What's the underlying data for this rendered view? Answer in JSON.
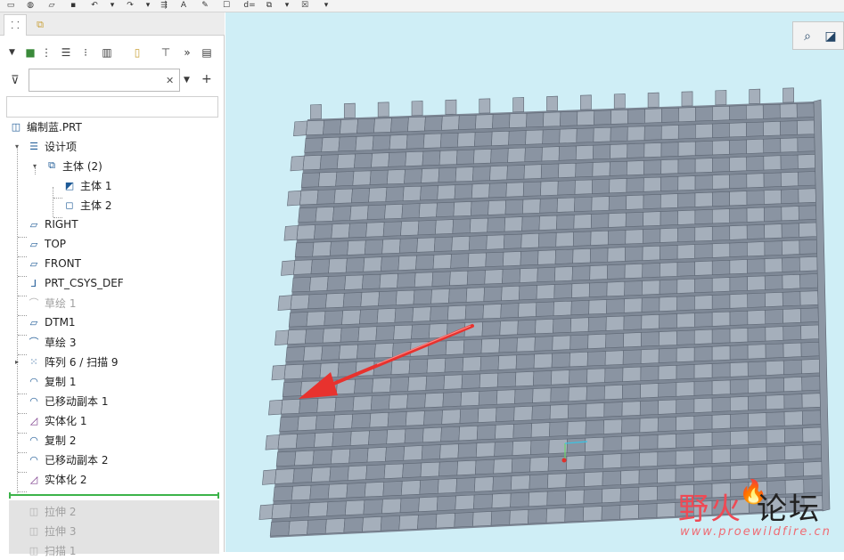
{
  "colors": {
    "accent": "#1e5a96",
    "viewport_bg": "#cfeef6",
    "weave": "#9aa4b0",
    "arrow": "#e8322e",
    "insert_line": "#3cb34a",
    "watermark": "#ee4a55"
  },
  "qat": {
    "icons": [
      "new-file-icon",
      "open-icon",
      "open-folder-icon",
      "save-icon",
      "undo-icon",
      "dropdown-icon",
      "redo-icon",
      "dropdown-icon",
      "regenerate-icon",
      "annotation-icon",
      "eraser-icon",
      "window-icon",
      "d-equals-icon",
      "layers-icon",
      "dropdown-icon",
      "close-windows-icon",
      "customize-icon"
    ],
    "d_label": "d="
  },
  "tabs": [
    {
      "name": "model-tree-tab",
      "glyph": "⸬"
    },
    {
      "name": "layer-tab",
      "glyph": "⧉"
    }
  ],
  "toolbar": {
    "more_label": "»"
  },
  "search": {
    "value": "",
    "placeholder": ""
  },
  "tree": {
    "root": {
      "label": "编制蓝.PRT"
    },
    "items": [
      {
        "label": "设计项",
        "icon": "design-items-icon",
        "dim": false
      },
      {
        "label": "主体 (2)",
        "icon": "bodies-icon",
        "dim": false
      },
      {
        "label": "主体 1",
        "icon": "body-icon",
        "dim": false
      },
      {
        "label": "主体 2",
        "icon": "body-icon",
        "dim": false
      },
      {
        "label": "RIGHT",
        "icon": "datum-plane-icon",
        "dim": false
      },
      {
        "label": "TOP",
        "icon": "datum-plane-icon",
        "dim": false
      },
      {
        "label": "FRONT",
        "icon": "datum-plane-icon",
        "dim": false
      },
      {
        "label": "PRT_CSYS_DEF",
        "icon": "csys-icon",
        "dim": false
      },
      {
        "label": "草绘 1",
        "icon": "sketch-icon",
        "dim": true
      },
      {
        "label": "DTM1",
        "icon": "datum-plane-icon",
        "dim": false
      },
      {
        "label": "草绘 3",
        "icon": "sketch-icon",
        "dim": false
      },
      {
        "label": "阵列 6 / 扫描 9",
        "icon": "pattern-icon",
        "dim": false
      },
      {
        "label": "复制 1",
        "icon": "copy-icon",
        "dim": false
      },
      {
        "label": "已移动副本 1",
        "icon": "moved-copy-icon",
        "dim": false
      },
      {
        "label": "实体化 1",
        "icon": "solidify-icon",
        "dim": false
      },
      {
        "label": "复制 2",
        "icon": "copy-icon",
        "dim": false
      },
      {
        "label": "已移动副本 2",
        "icon": "moved-copy-icon",
        "dim": false
      },
      {
        "label": "实体化 2",
        "icon": "solidify-icon",
        "dim": false
      },
      {
        "label": "拉伸 2",
        "icon": "extrude-icon",
        "dim": true
      },
      {
        "label": "拉伸 3",
        "icon": "extrude-icon",
        "dim": true
      },
      {
        "label": "扫描 1",
        "icon": "sweep-icon",
        "dim": true
      }
    ]
  },
  "watermark": {
    "cn_red": "野火",
    "cn_black": "论坛",
    "url": "www.proewildfire.cn"
  }
}
